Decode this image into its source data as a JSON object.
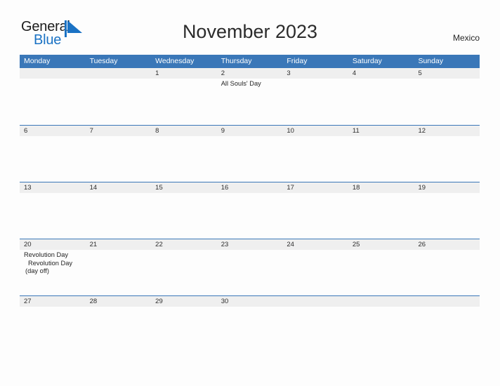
{
  "brand": {
    "name_part1": "General",
    "name_part2": "Blue",
    "mark_icon": "blue-triangle-flag-icon",
    "accent_color": "#1a72c4"
  },
  "header": {
    "title": "November 2023",
    "country": "Mexico"
  },
  "theme": {
    "header_blue": "#3a77b8",
    "band_gray": "#efefef",
    "page_background": "#fdfdfd",
    "text_dark": "#2d2d2d"
  },
  "calendar": {
    "month": "November",
    "year": "2023",
    "weekday_headers": [
      "Monday",
      "Tuesday",
      "Wednesday",
      "Thursday",
      "Friday",
      "Saturday",
      "Sunday"
    ],
    "weeks": [
      [
        {
          "day": "",
          "events": []
        },
        {
          "day": "",
          "events": []
        },
        {
          "day": "1",
          "events": []
        },
        {
          "day": "2",
          "events": [
            {
              "text": "All Souls' Day",
              "indented": false
            }
          ]
        },
        {
          "day": "3",
          "events": []
        },
        {
          "day": "4",
          "events": []
        },
        {
          "day": "5",
          "events": []
        }
      ],
      [
        {
          "day": "6",
          "events": []
        },
        {
          "day": "7",
          "events": []
        },
        {
          "day": "8",
          "events": []
        },
        {
          "day": "9",
          "events": []
        },
        {
          "day": "10",
          "events": []
        },
        {
          "day": "11",
          "events": []
        },
        {
          "day": "12",
          "events": []
        }
      ],
      [
        {
          "day": "13",
          "events": []
        },
        {
          "day": "14",
          "events": []
        },
        {
          "day": "15",
          "events": []
        },
        {
          "day": "16",
          "events": []
        },
        {
          "day": "17",
          "events": []
        },
        {
          "day": "18",
          "events": []
        },
        {
          "day": "19",
          "events": []
        }
      ],
      [
        {
          "day": "20",
          "events": [
            {
              "text": "Revolution Day",
              "indented": false
            },
            {
              "text": "Revolution Day (day off)",
              "indented": true
            }
          ]
        },
        {
          "day": "21",
          "events": []
        },
        {
          "day": "22",
          "events": []
        },
        {
          "day": "23",
          "events": []
        },
        {
          "day": "24",
          "events": []
        },
        {
          "day": "25",
          "events": []
        },
        {
          "day": "26",
          "events": []
        }
      ],
      [
        {
          "day": "27",
          "events": []
        },
        {
          "day": "28",
          "events": []
        },
        {
          "day": "29",
          "events": []
        },
        {
          "day": "30",
          "events": []
        },
        {
          "day": "",
          "events": []
        },
        {
          "day": "",
          "events": []
        },
        {
          "day": "",
          "events": []
        }
      ]
    ]
  }
}
